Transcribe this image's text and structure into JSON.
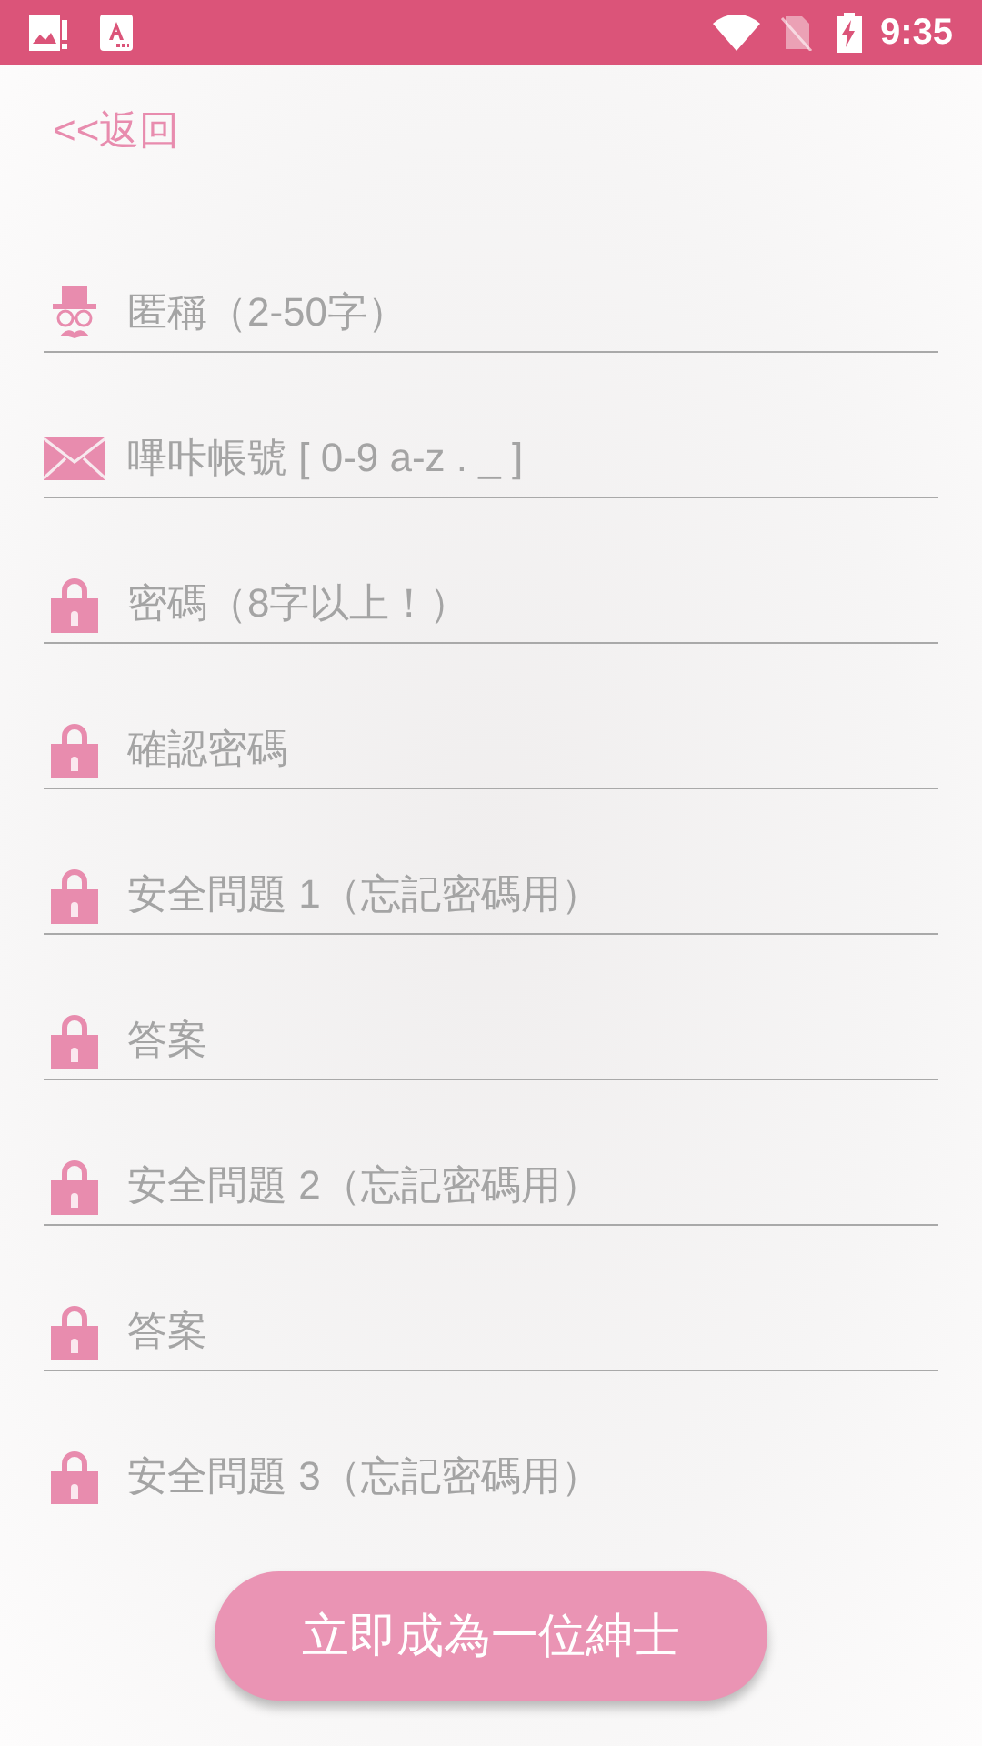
{
  "status_bar": {
    "time": "9:35"
  },
  "back_link": "<<返回",
  "fields": [
    {
      "kind": "hat",
      "placeholder": "匿稱（2-50字）"
    },
    {
      "kind": "mail",
      "placeholder": "嗶咔帳號 [ 0-9 a-z . _ ]"
    },
    {
      "kind": "lock",
      "placeholder": "密碼（8字以上！）"
    },
    {
      "kind": "lock",
      "placeholder": "確認密碼"
    },
    {
      "kind": "lock",
      "placeholder": "安全問題 1（忘記密碼用）"
    },
    {
      "kind": "lock",
      "placeholder": "答案"
    },
    {
      "kind": "lock",
      "placeholder": "安全問題 2（忘記密碼用）"
    },
    {
      "kind": "lock",
      "placeholder": "答案"
    },
    {
      "kind": "lock",
      "placeholder": "安全問題 3（忘記密碼用）"
    }
  ],
  "submit_button": "立即成為一位紳士"
}
